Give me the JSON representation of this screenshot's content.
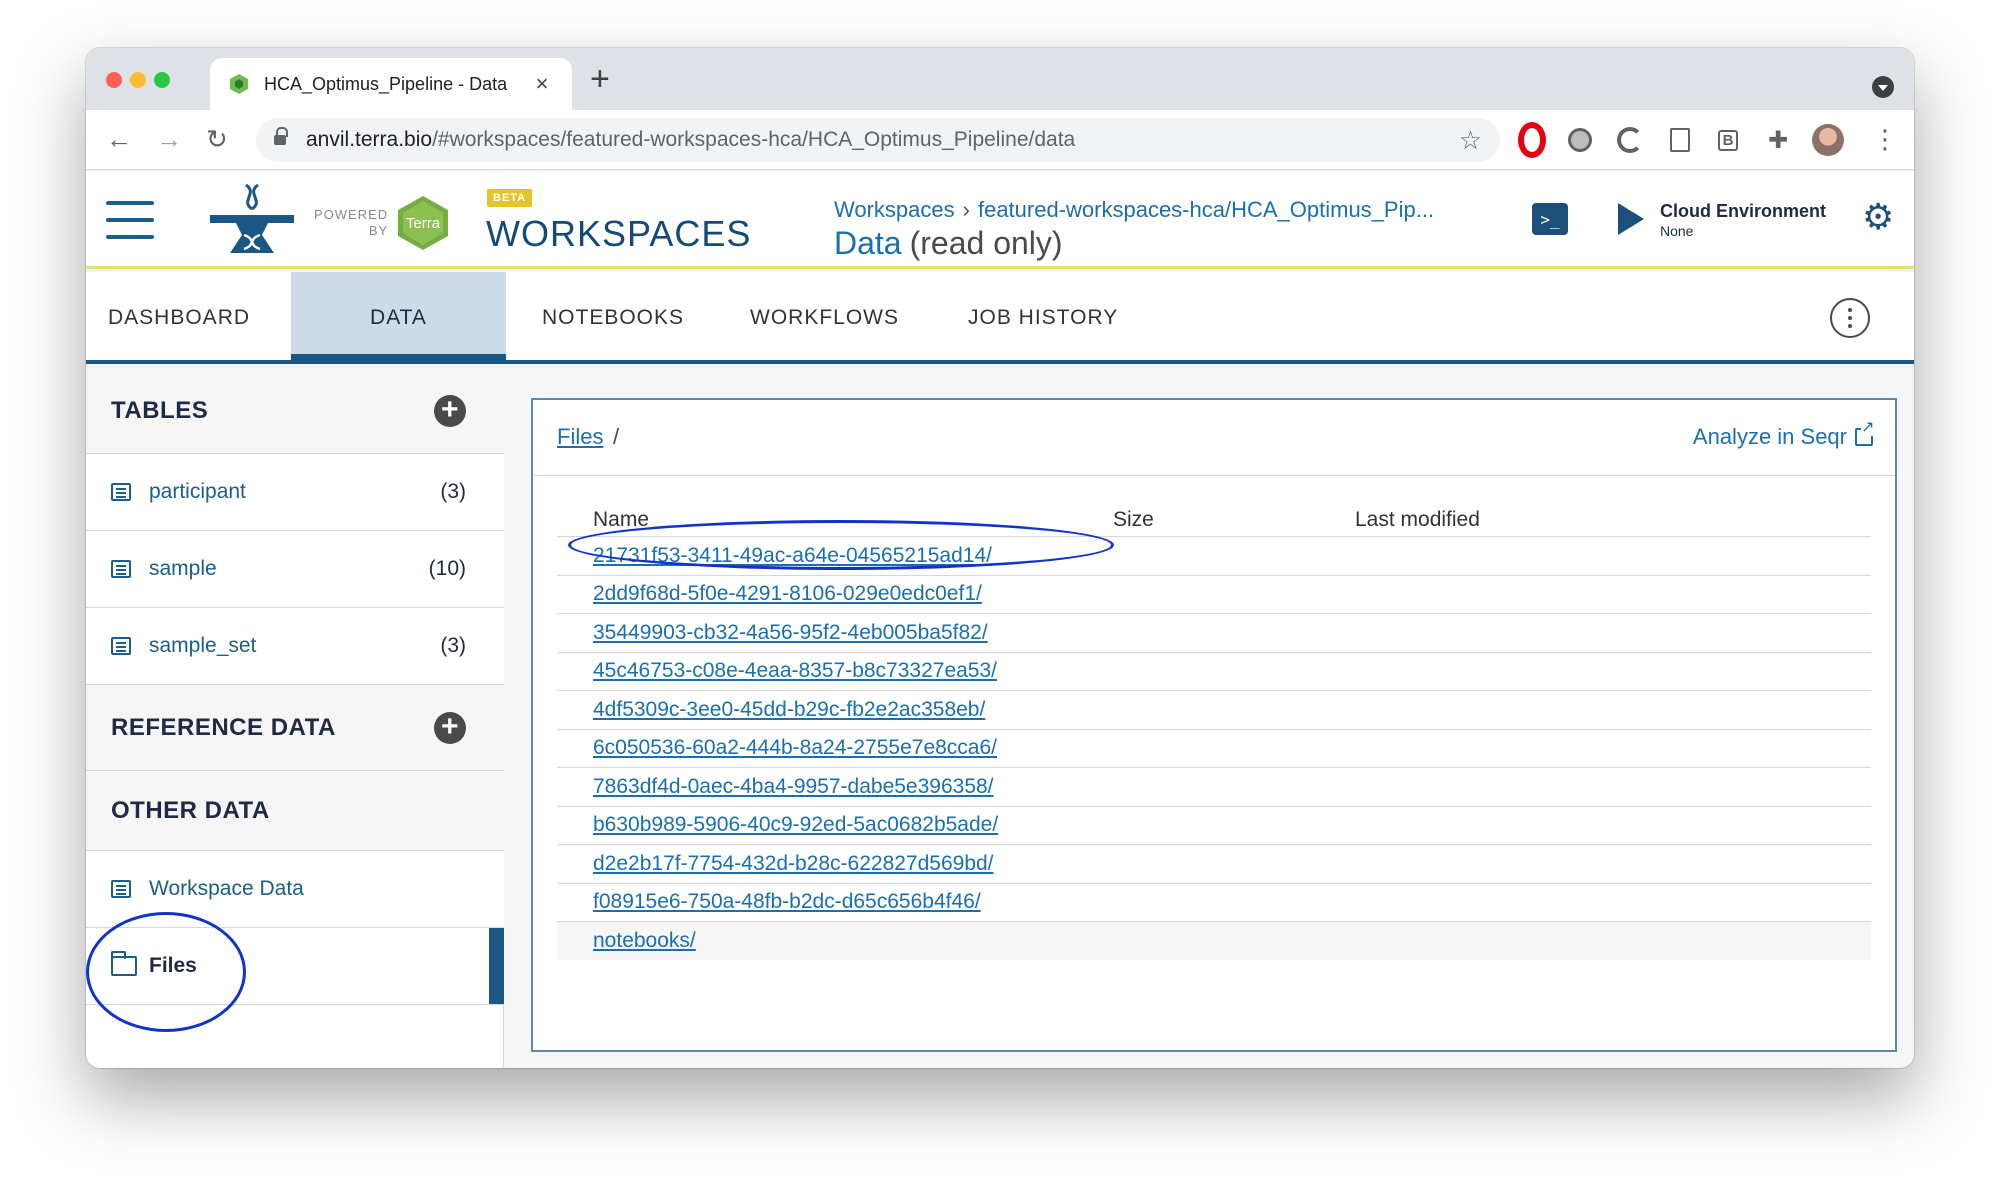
{
  "browser": {
    "tab_title": "HCA_Optimus_Pipeline - Data",
    "tab_close": "×",
    "new_tab": "+",
    "url_host": "anvil.terra.bio",
    "url_path": "/#workspaces/featured-workspaces-hca/HCA_Optimus_Pipeline/data",
    "back": "←",
    "forward": "→",
    "reload": "↻",
    "star": "☆",
    "puzzle": "✚",
    "menu": "⋮",
    "ext_b": "B"
  },
  "header": {
    "powered_by": "POWERED\nBY",
    "terra_logo_text": "Terra",
    "beta": "BETA",
    "app_title": "WORKSPACES",
    "breadcrumb_root": "Workspaces",
    "breadcrumb_sep": "›",
    "breadcrumb_workspace": "featured-workspaces-hca/HCA_Optimus_Pip...",
    "page_title": "Data",
    "page_subtitle": "(read only)",
    "terminal": ">_",
    "cloud_env_label": "Cloud Environment",
    "cloud_env_status": "None",
    "gear": "⚙"
  },
  "tabs": [
    {
      "label": "DASHBOARD",
      "active": false
    },
    {
      "label": "DATA",
      "active": true
    },
    {
      "label": "NOTEBOOKS",
      "active": false
    },
    {
      "label": "WORKFLOWS",
      "active": false
    },
    {
      "label": "JOB HISTORY",
      "active": false
    }
  ],
  "sidebar": {
    "tables_title": "TABLES",
    "tables": [
      {
        "label": "participant",
        "count": "(3)"
      },
      {
        "label": "sample",
        "count": "(10)"
      },
      {
        "label": "sample_set",
        "count": "(3)"
      }
    ],
    "reference_title": "REFERENCE DATA",
    "other_title": "OTHER DATA",
    "workspace_data": "Workspace Data",
    "files": "Files",
    "plus": "+"
  },
  "files_panel": {
    "crumb_files": "Files",
    "crumb_slash": "/",
    "analyze": "Analyze in Seqr",
    "col_name": "Name",
    "col_size": "Size",
    "col_modified": "Last modified",
    "rows": [
      "21731f53-3411-49ac-a64e-04565215ad14/",
      "2dd9f68d-5f0e-4291-8106-029e0edc0ef1/",
      "35449903-cb32-4a56-95f2-4eb005ba5f82/",
      "45c46753-c08e-4eaa-8357-b8c73327ea53/",
      "4df5309c-3ee0-45dd-b29c-fb2e2ac358eb/",
      "6c050536-60a2-444b-8a24-2755e7e8cca6/",
      "7863df4d-0aec-4ba4-9957-dabe5e396358/",
      "b630b989-5906-40c9-92ed-5ac0682b5ade/",
      "d2e2b17f-7754-432d-b28c-622827d569bd/",
      "f08915e6-750a-48fb-b2dc-d65c656b4f46/",
      "notebooks/"
    ]
  },
  "colors": {
    "brand_blue": "#1a5784",
    "link_blue": "#1a6fb0",
    "annotation_blue": "#1133cc",
    "beta_yellow": "#e5c42a"
  }
}
